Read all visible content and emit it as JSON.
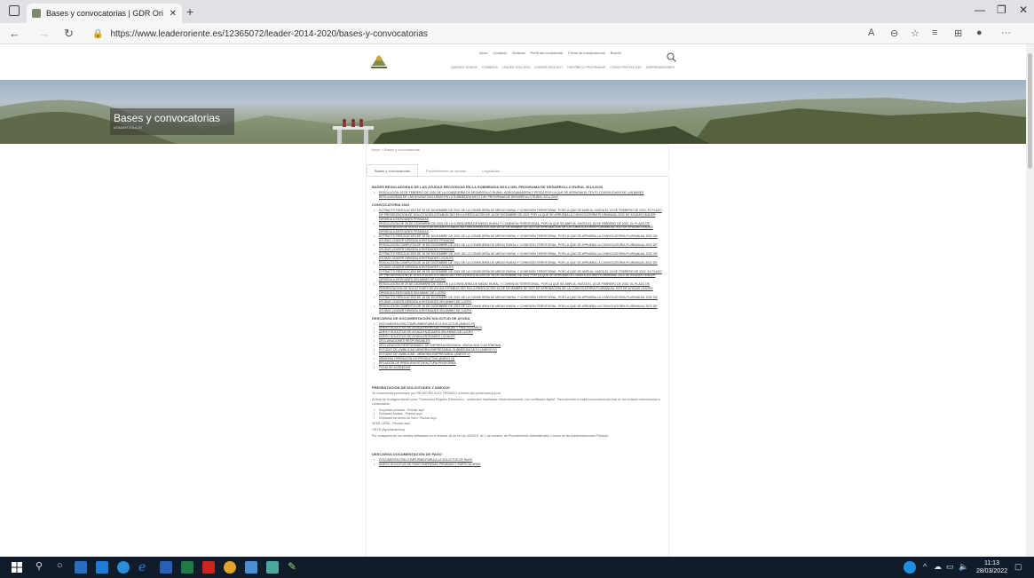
{
  "browser": {
    "tab_title": "Bases y convocatorias | GDR Ori",
    "url": "https://www.leaderoriente.es/12365072/leader-2014-2020/bases-y-convocatorias"
  },
  "site": {
    "topnav": [
      "Inicio",
      "Contacto",
      "Noticias",
      "Perfil del contratante",
      "Portal de transparencia",
      "Boletín"
    ],
    "subnav": [
      "Quiénes somos",
      "Comarca",
      "Leader 2014-2020",
      "Leader 2023-2027",
      "Histórico programas",
      "Otros proyectos",
      "Emprendedores"
    ]
  },
  "banner": {
    "title": "Bases y convocatorias",
    "subtitle": "LEADER 2014-20"
  },
  "content": {
    "breadcrumb": "Inicio > Bases y convocatorias",
    "tabs": [
      "Bases y convocatorias",
      "Procedimiento de ayudas",
      "Legislación"
    ],
    "sec1_title": "Bases reguladoras de las ayudas recogidas en la submedida M19.2 del programa de desarrollo rural 2014-2020",
    "sec1_link": "Resolución 19 de febrero de 2020 de la Consejería de Desarrollo Rural, Agroganadería y Pesca por la que se aprueba el texto consolidado de las bases reguladoras de las ayudas incluidas en la submedida M19.2 del programa de desarrollo rural 2014-2020",
    "sec2_title": "Convocatoria 2022",
    "sec2_items": [
      "Extracto Resolución de 29 de diciembre de 2021 de la Consejería de Medio Rural y Cohesión Territorial, por la que se amplía, hasta el 15 de febrero de 2022, el plazo de presentación de solicitudes establecido en la resolución de 16 de diciembre de 2021 por la que se aprueba la convocatoria plurianual 2022 de ayudas Leader dirigida a entidades privadas",
      "Resolución de 29 de diciembre de 2021 de la Consejería de Medio Rural y Cohesión Territorial, por la que se amplía, hasta el 15 de febrero de 2022, el plazo de presentación de solicitudes de ayuda establecido en la resolución 16 de diciembre de 2021 de aprobación de la convocatoria plurianual 2022 de ayudas Leader dirigida a entidades privadas",
      "Extracto Resolución de 16 de diciembre de 2021 de la Consejería de Medio Rural y Cohesión Territorial, por la que se aprueba la convocatoria plurianual 2022 de ayudas Leader dirigida a entidades privadas",
      "Resolución completa de 16 de diciembre de 2021 de la Consejería de Medio Rural y Cohesión Territorial, por la que se aprueba la convocatoria plurianual 2022 de ayudas Leader dirigida a entidades privadas",
      "Extracto Resolución de 16 de diciembre de 2021 de la Consejería de Medio Rural y Cohesión Territorial, por la que se aprueba la convocatoria plurianual 2022 de ayudas Leader dirigida a entidades locales",
      "Resolución completa de 16 de diciembre de 2021 de la Consejería de Medio Rural y Cohesión Territorial, por la que se aprueba la convocatoria plurianual 2022 de ayudas Leader dirigida a entidades locales",
      "Extracto Resolución de 29 de diciembre de 2021 de la Consejería de Medio Rural y Cohesión Territorial, por la que se amplía, hasta el 15 de febrero de 2022, el plazo de presentación de solicitudes establecido en la resolución de 16 de diciembre de 2021 por la que se aprueba la convocatoria plurianual 2022 de ayudas Leader dirigida a entidades sin ánimo de lucro",
      "Resolución de 29 de diciembre de 2021 de la Consejería de Medio Rural y Cohesión Territorial, por la que se amplía, hasta el 15 de febrero de 2022, el plazo de presentación de solicitudes de ayuda establecido en la resolución 16 de diciembre de 2021 de aprobación de la convocatoria plurianual 2022 de ayudas Leader dirigida a entidades sin ánimo de lucro",
      "Extracto Resolución de 16 de diciembre de 2021 de la Consejería de Medio Rural y Cohesión Territorial, por la que se aprueba la convocatoria plurianual 2022 de ayudas Leader dirigida a entidades sin ánimo de lucro",
      "Resolución completa de 16 de diciembre de 2021 de la Consejería de Medio Rural y Cohesión Territorial, por la que se aprueba la convocatoria plurianual 2022 de ayudas Leader dirigida a entidades sin ánimo de lucro"
    ],
    "sec3_title": "Descarga de documentación solicitud de ayuda",
    "sec3_items": [
      "Documentación complementaria a la solicitud (Anexo III)",
      "Anexo solicitud de ayuda empresas privadas y particulares",
      "Anexo solicitud de ayuda entidades sin ánimo de lucro",
      "Anexo solicitud de ayuda entidades locales",
      "Declaraciones responsables",
      "Declaración responsable de empresa asociada, vinculada o autónoma",
      "Estudio de viabilidad memoria empresarial submedida M19.2 (Anexo IV)",
      "Estudio de viabilidad - memoria empresarial (Anexo V)",
      "Memoria operación no productiva (Anexo VI)",
      "Relación de presupuesto/factura proforma",
      "Ficha de acreedor"
    ],
    "sec4_title": "Presentación de solicitudes y anexos",
    "sec4_p1": "Se recomienda presentarlo por REGISTRO ELECTRÓNICO a través del portal www.jcyl.es",
    "sec4_p2": "Al final de la página donde pone \"Formulario Registro Electrónico - solicitudes tramitadas electrónicamente, con certificado digital\". Para acceder a cada convocatoria pinchar en los enlaces relacionados a continuación:",
    "sec4_items": [
      "Empresas privadas - Pinchar aquí",
      "Entidades locales - Pinchar aquí",
      "Entidades sin ánimo de lucro- Pinchar aquí"
    ],
    "sec4_p3": "SEDE LEÑA - Pinchar aquí",
    "sec4_p4": "ORVE (Ayuntamientos).",
    "sec4_p5": "Por cualquiera de los medios señalados en el artículo 16 de la Ley 39/2015, de 1 de octubre, de Procedimiento Administrativo Común de las Administraciones Públicas.",
    "sec5_title": "Descarga documentación de pago",
    "sec5_items": [
      "Documentación complementaria a la solicitud de pago",
      "Anexo solicitud de pago empresas privadas y particulares"
    ]
  },
  "taskbar": {
    "time": "11:13",
    "date": "28/03/2022"
  }
}
